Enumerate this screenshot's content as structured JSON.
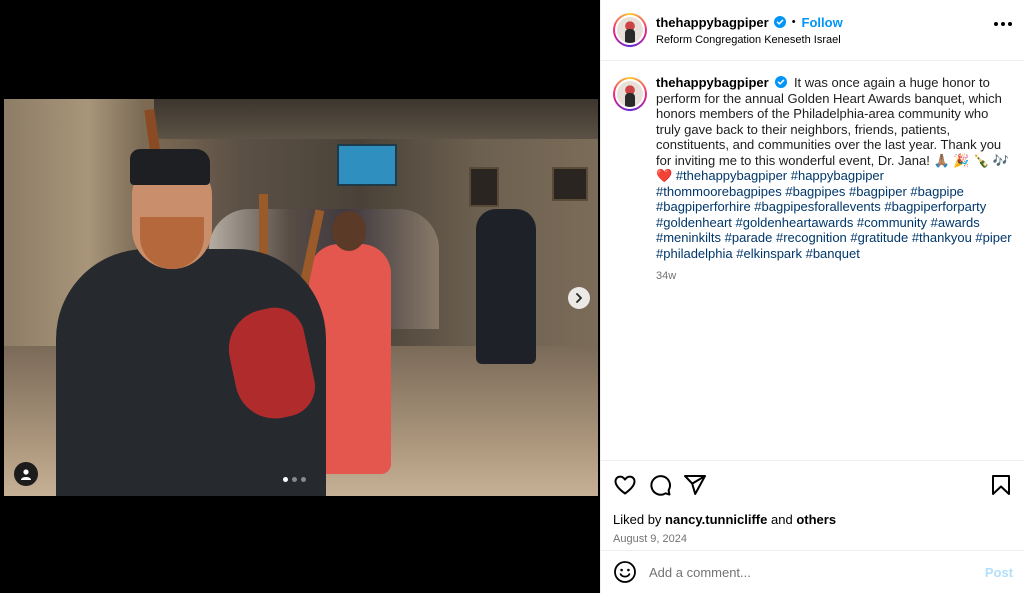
{
  "post": {
    "username": "thehappybagpiper",
    "separator": "•",
    "follow_label": "Follow",
    "location": "Reform Congregation Keneseth Israel"
  },
  "caption": {
    "username": "thehappybagpiper",
    "text": "It was once again a huge honor to perform for the annual Golden Heart Awards banquet, which honors members of the Philadelphia-area community who truly gave back to their neighbors, friends, patients, constituents, and communities over the last year. Thank you for inviting me to this wonderful event, Dr. Jana! 🙏🏽 🎉 🍾 🎶 ❤️",
    "hashtags": "#thehappybagpiper #happybagpiper #thommoorebagpipes #bagpipes #bagpiper #bagpipe #bagpiperforhire #bagpipesforallevents #bagpiperforparty #goldenheart #goldenheartawards #community #awards #meninkilts #parade #recognition #gratitude #thankyou #piper #philadelphia #elkinspark #banquet",
    "time_ago": "34w"
  },
  "engagement": {
    "liked_by_prefix": "Liked by",
    "liked_by_user": "nancy.tunnicliffe",
    "and_label": "and",
    "others_label": "others",
    "date": "August 9, 2024"
  },
  "comment": {
    "placeholder": "Add a comment...",
    "post_label": "Post"
  },
  "carousel": {
    "slide_count": 3,
    "active_index": 0
  },
  "icons": {
    "like": "heart-icon",
    "comment": "comment-icon",
    "share": "share-icon",
    "save": "bookmark-icon",
    "emoji": "emoji-icon",
    "next": "chevron-right-icon",
    "tag": "user-tag-icon",
    "more": "more-options-icon",
    "verified": "verified-badge-icon"
  },
  "colors": {
    "link_blue": "#0095f6",
    "hashtag_blue": "#00376b",
    "muted_gray": "#737373",
    "post_disabled": "#b2dffc"
  }
}
